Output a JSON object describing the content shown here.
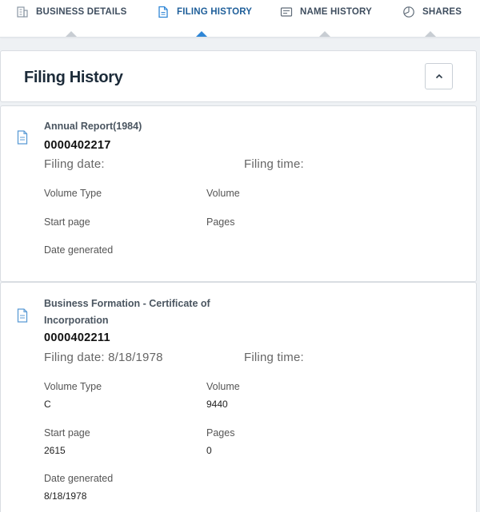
{
  "tabs": [
    {
      "label": "BUSINESS DETAILS",
      "icon": "building-icon",
      "active": false
    },
    {
      "label": "FILING HISTORY",
      "icon": "document-icon",
      "active": true
    },
    {
      "label": "NAME HISTORY",
      "icon": "id-card-icon",
      "active": false
    },
    {
      "label": "SHARES",
      "icon": "pie-chart-icon",
      "active": false
    }
  ],
  "panel": {
    "title": "Filing History"
  },
  "labels": {
    "filing_date": "Filing date:",
    "filing_time": "Filing time:",
    "volume_type": "Volume Type",
    "volume": "Volume",
    "start_page": "Start page",
    "pages": "Pages",
    "date_generated": "Date generated"
  },
  "filings": [
    {
      "title": "Annual Report(1984)",
      "number": "0000402217",
      "filing_date": "Filing date:",
      "filing_time": "Filing time:",
      "volume_type": "",
      "volume": "",
      "start_page": "",
      "pages": "",
      "date_generated": ""
    },
    {
      "title": "Business Formation - Certificate of Incorporation",
      "number": "0000402211",
      "filing_date": "Filing date: 8/18/1978",
      "filing_time": "Filing time:",
      "volume_type": "C",
      "volume": "9440",
      "start_page": "2615",
      "pages": "0",
      "date_generated": "8/18/1978"
    }
  ],
  "colors": {
    "accent": "#2f86d6",
    "active_tab_text": "#1f5f9a",
    "tab_text": "#3f4e5f",
    "icon": "#5b9bd5"
  }
}
